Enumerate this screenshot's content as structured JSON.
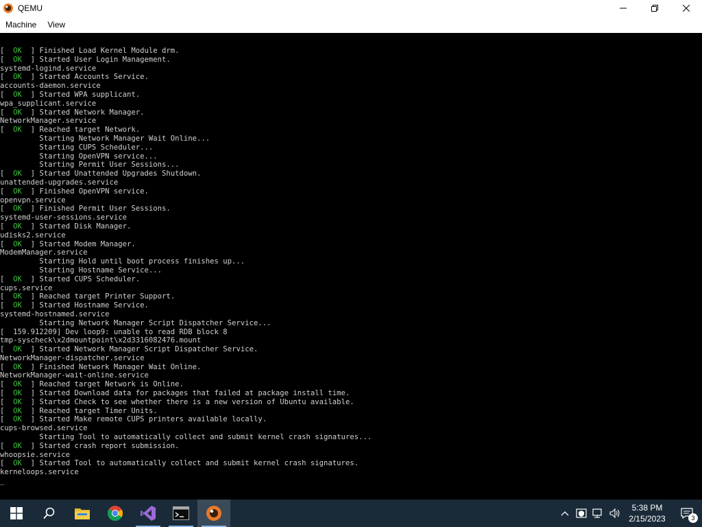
{
  "window": {
    "title": "QEMU",
    "menu": [
      "Machine",
      "View"
    ]
  },
  "console": {
    "lines": [
      {
        "ok": true,
        "text": "Finished Load Kernel Module drm."
      },
      {
        "ok": true,
        "text": "Started User Login Management."
      },
      {
        "ok": false,
        "text": "systemd-logind.service"
      },
      {
        "ok": true,
        "text": "Started Accounts Service."
      },
      {
        "ok": false,
        "text": "accounts-daemon.service"
      },
      {
        "ok": true,
        "text": "Started WPA supplicant."
      },
      {
        "ok": false,
        "text": "wpa_supplicant.service"
      },
      {
        "ok": true,
        "text": "Started Network Manager."
      },
      {
        "ok": false,
        "text": "NetworkManager.service"
      },
      {
        "ok": true,
        "text": "Reached target Network."
      },
      {
        "ok": false,
        "text": "         Starting Network Manager Wait Online..."
      },
      {
        "ok": false,
        "text": "         Starting CUPS Scheduler..."
      },
      {
        "ok": false,
        "text": "         Starting OpenVPN service..."
      },
      {
        "ok": false,
        "text": "         Starting Permit User Sessions..."
      },
      {
        "ok": true,
        "text": "Started Unattended Upgrades Shutdown."
      },
      {
        "ok": false,
        "text": "unattended-upgrades.service"
      },
      {
        "ok": true,
        "text": "Finished OpenVPN service."
      },
      {
        "ok": false,
        "text": "openvpn.service"
      },
      {
        "ok": true,
        "text": "Finished Permit User Sessions."
      },
      {
        "ok": false,
        "text": "systemd-user-sessions.service"
      },
      {
        "ok": true,
        "text": "Started Disk Manager."
      },
      {
        "ok": false,
        "text": "udisks2.service"
      },
      {
        "ok": true,
        "text": "Started Modem Manager."
      },
      {
        "ok": false,
        "text": "ModemManager.service"
      },
      {
        "ok": false,
        "text": "         Starting Hold until boot process finishes up..."
      },
      {
        "ok": false,
        "text": "         Starting Hostname Service..."
      },
      {
        "ok": true,
        "text": "Started CUPS Scheduler."
      },
      {
        "ok": false,
        "text": "cups.service"
      },
      {
        "ok": true,
        "text": "Reached target Printer Support."
      },
      {
        "ok": true,
        "text": "Started Hostname Service."
      },
      {
        "ok": false,
        "text": "systemd-hostnamed.service"
      },
      {
        "ok": false,
        "text": "         Starting Network Manager Script Dispatcher Service..."
      },
      {
        "ok": false,
        "text": "[  159.912209] Dev loop9: unable to read RDB block 8"
      },
      {
        "ok": false,
        "text": "tmp-syscheck\\x2dmountpoint\\x2d3316082476.mount"
      },
      {
        "ok": true,
        "text": "Started Network Manager Script Dispatcher Service."
      },
      {
        "ok": false,
        "text": "NetworkManager-dispatcher.service"
      },
      {
        "ok": true,
        "text": "Finished Network Manager Wait Online."
      },
      {
        "ok": false,
        "text": "NetworkManager-wait-online.service"
      },
      {
        "ok": true,
        "text": "Reached target Network is Online."
      },
      {
        "ok": true,
        "text": "Started Download data for packages that failed at package install time."
      },
      {
        "ok": true,
        "text": "Started Check to see whether there is a new version of Ubuntu available."
      },
      {
        "ok": true,
        "text": "Reached target Timer Units."
      },
      {
        "ok": true,
        "text": "Started Make remote CUPS printers available locally."
      },
      {
        "ok": false,
        "text": "cups-browsed.service"
      },
      {
        "ok": false,
        "text": "         Starting Tool to automatically collect and submit kernel crash signatures..."
      },
      {
        "ok": true,
        "text": "Started crash report submission."
      },
      {
        "ok": false,
        "text": "whoopsie.service"
      },
      {
        "ok": true,
        "text": "Started Tool to automatically collect and submit kernel crash signatures."
      },
      {
        "ok": false,
        "text": "kerneloops.service"
      }
    ],
    "ok_label": "  OK  ",
    "cursor": "_"
  },
  "taskbar": {
    "apps": [
      {
        "name": "start-button",
        "icon": "windows-logo-icon",
        "running": false
      },
      {
        "name": "search-button",
        "icon": "search-icon",
        "running": false
      },
      {
        "name": "file-explorer-button",
        "icon": "folder-icon",
        "running": false
      },
      {
        "name": "chrome-button",
        "icon": "chrome-icon",
        "running": false
      },
      {
        "name": "visual-studio-button",
        "icon": "visual-studio-icon",
        "running": true
      },
      {
        "name": "terminal-button",
        "icon": "terminal-icon",
        "running": true
      },
      {
        "name": "qemu-button",
        "icon": "qemu-icon",
        "running": true,
        "active": true
      }
    ],
    "clock_time": "5:38 PM",
    "clock_date": "2/15/2023",
    "notification_count": "3"
  }
}
